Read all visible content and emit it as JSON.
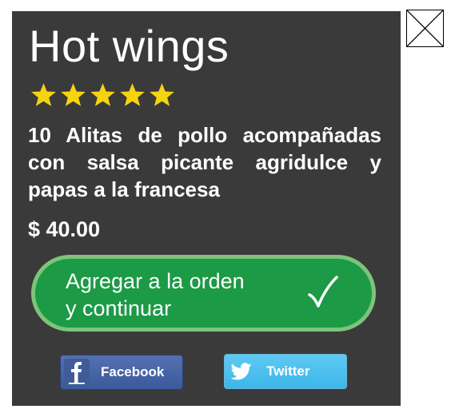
{
  "dialog": {
    "title": "Hot wings",
    "rating": 5,
    "rating_max": 5,
    "description": "10 Alitas de pollo acompañadas con salsa picante agridulce y papas a la francesa",
    "price": "$ 40.00",
    "add_button": {
      "line1": "Agregar a la orden",
      "line2": "y continuar",
      "icon": "check-icon"
    },
    "close_icon": "close-icon"
  },
  "share": {
    "facebook_label": "Facebook",
    "twitter_label": "Twitter"
  },
  "colors": {
    "panel_bg": "#3a3a3a",
    "star": "#f5d40f",
    "button_green": "#1c9a46",
    "button_border": "#7dc47a",
    "facebook_blue": "#3b5a9a",
    "twitter_blue": "#4ec0ef"
  }
}
